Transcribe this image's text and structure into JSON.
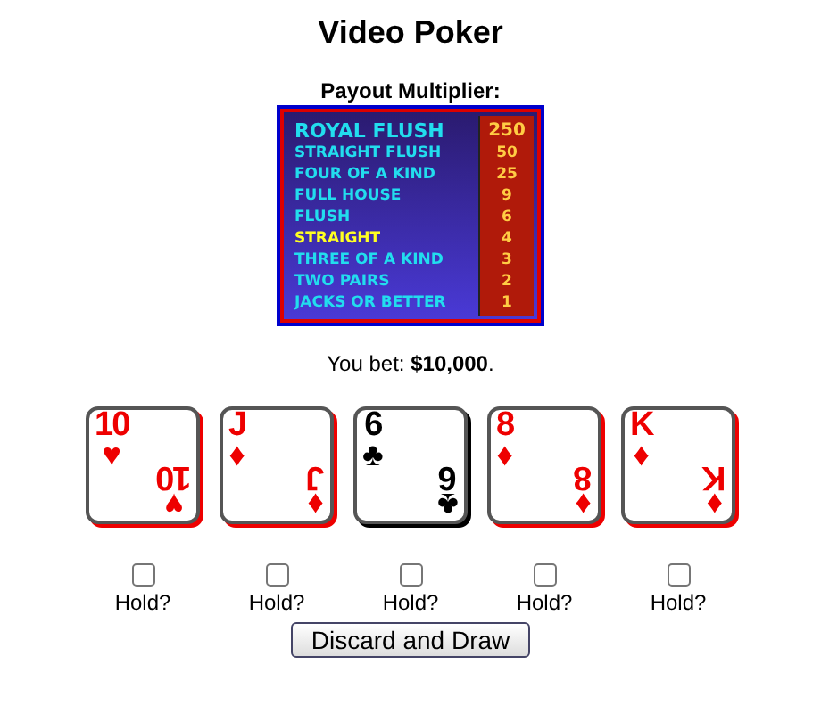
{
  "title": "Video Poker",
  "payout": {
    "heading": "Payout Multiplier:",
    "rows": [
      {
        "hand": "ROYAL FLUSH",
        "multiplier": "250",
        "selected": false
      },
      {
        "hand": "STRAIGHT FLUSH",
        "multiplier": "50",
        "selected": false
      },
      {
        "hand": "FOUR OF A KIND",
        "multiplier": "25",
        "selected": false
      },
      {
        "hand": "FULL HOUSE",
        "multiplier": "9",
        "selected": false
      },
      {
        "hand": "FLUSH",
        "multiplier": "6",
        "selected": false
      },
      {
        "hand": "STRAIGHT",
        "multiplier": "4",
        "selected": true
      },
      {
        "hand": "THREE OF A KIND",
        "multiplier": "3",
        "selected": false
      },
      {
        "hand": "TWO PAIRS",
        "multiplier": "2",
        "selected": false
      },
      {
        "hand": "JACKS OR BETTER",
        "multiplier": "1",
        "selected": false
      }
    ]
  },
  "bet": "You bet: **$10,000**.",
  "cards": [
    {
      "top_rank": "10",
      "top_suit": "♥",
      "bottom_rank": "10",
      "bottom_suit": "♥",
      "color": "#ee0000",
      "hold_label": "Hold?",
      "checked": false
    },
    {
      "top_rank": "J",
      "top_suit": "♦",
      "bottom_rank": "J",
      "bottom_suit": "♦",
      "color": "#ee0000",
      "hold_label": "Hold?",
      "checked": false
    },
    {
      "top_rank": "6",
      "top_suit": "♣",
      "bottom_rank": "6",
      "bottom_suit": "♣",
      "color": "#000000",
      "hold_label": "Hold?",
      "checked": false
    },
    {
      "top_rank": "8",
      "top_suit": "♦",
      "bottom_rank": "8",
      "bottom_suit": "♦",
      "color": "#ee0000",
      "hold_label": "Hold?",
      "checked": false
    },
    {
      "top_rank": "K",
      "top_suit": "♦",
      "bottom_rank": "K",
      "bottom_suit": "♦",
      "color": "#ee0000",
      "hold_label": "Hold?",
      "checked": false
    }
  ],
  "button": "Discard and Draw"
}
